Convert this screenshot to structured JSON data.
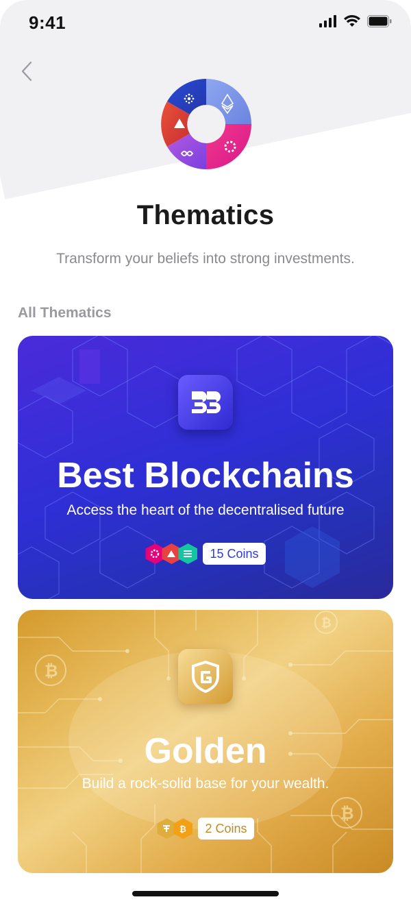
{
  "status_bar": {
    "time": "9:41"
  },
  "header": {
    "title": "Thematics",
    "subtitle": "Transform your beliefs into strong investments."
  },
  "section": {
    "label": "All Thematics"
  },
  "cards": [
    {
      "title": "Best Blockchains",
      "description": "Access the heart of the decentralised future",
      "coins_label": "15 Coins",
      "icon": "best-blockchains-icon",
      "accent": "#2f3bd6"
    },
    {
      "title": "Golden",
      "description": "Build a rock-solid base for your wealth.",
      "coins_label": "2 Coins",
      "icon": "golden-shield-icon",
      "accent": "#c08a1e"
    }
  ],
  "colors": {
    "blue_card": "#2f2fd6",
    "gold_card": "#e3ad4c",
    "title_text": "#1b1b1b",
    "subtitle_text": "#8a8a8e"
  }
}
